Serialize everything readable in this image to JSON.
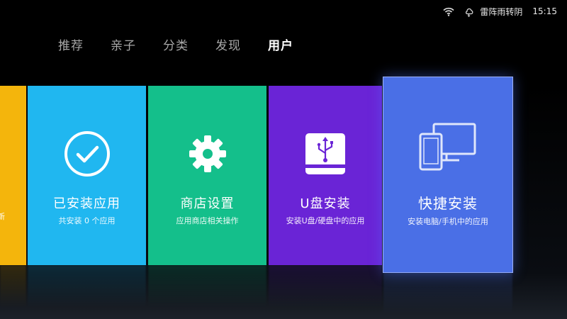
{
  "status": {
    "weather": "雷阵雨转阴",
    "time": "15:15",
    "icons": [
      "wifi-icon",
      "weather-icon"
    ]
  },
  "nav": {
    "tabs": [
      {
        "label": "推荐"
      },
      {
        "label": "亲子"
      },
      {
        "label": "分类"
      },
      {
        "label": "发现"
      },
      {
        "label": "用户",
        "active": true
      }
    ]
  },
  "cards": {
    "partial": {
      "edge_text": "新"
    },
    "installed": {
      "title": "已安装应用",
      "subtitle": "共安装 0 个应用",
      "icon": "check-circle-icon"
    },
    "store": {
      "title": "商店设置",
      "subtitle": "应用商店相关操作",
      "icon": "gear-icon"
    },
    "usb": {
      "title": "U盘安装",
      "subtitle": "安装U盘/硬盘中的应用",
      "icon": "usb-drive-icon"
    },
    "quick": {
      "title": "快捷安装",
      "subtitle": "安装电脑/手机中的应用",
      "icon": "devices-icon"
    }
  },
  "colors": {
    "partial": "#f4b50c",
    "installed": "#20b7f0",
    "store": "#14bf8b",
    "usb": "#6a24d6",
    "quick": "#4a6fe6"
  }
}
